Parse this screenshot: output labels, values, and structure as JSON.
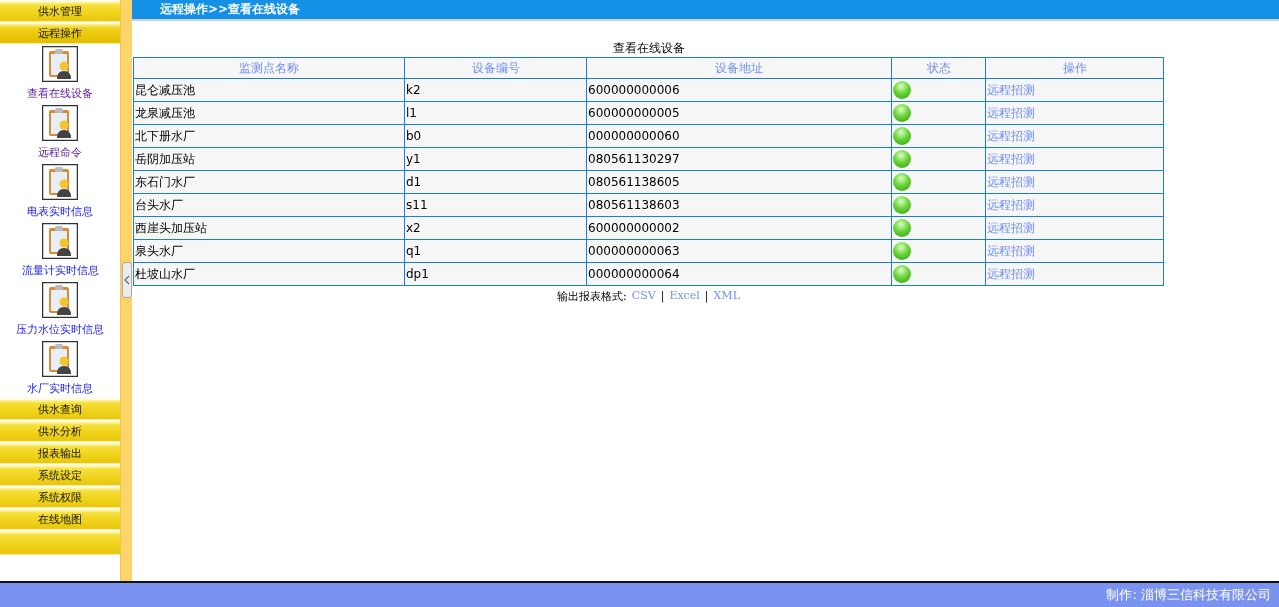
{
  "sidebar": {
    "top_menus": [
      {
        "label": "供水管理",
        "selected": false
      },
      {
        "label": "远程操作",
        "selected": true
      }
    ],
    "items": [
      {
        "label": "查看在线设备",
        "visited": true
      },
      {
        "label": "远程命令",
        "visited": true
      },
      {
        "label": "电表实时信息",
        "visited": false
      },
      {
        "label": "流量计实时信息",
        "visited": false
      },
      {
        "label": "压力水位实时信息",
        "visited": false
      },
      {
        "label": "水厂实时信息",
        "visited": false
      }
    ],
    "bottom_menus": [
      {
        "label": "供水查询",
        "selected": false
      },
      {
        "label": "供水分析",
        "selected": false
      },
      {
        "label": "报表输出",
        "selected": false
      },
      {
        "label": "系统设定",
        "selected": false
      },
      {
        "label": "系统权限",
        "selected": false
      },
      {
        "label": "在线地图",
        "selected": false
      }
    ]
  },
  "breadcrumb": "远程操作>>查看在线设备",
  "table": {
    "caption": "查看在线设备",
    "columns": [
      "监测点名称",
      "设备编号",
      "设备地址",
      "状态",
      "操作"
    ],
    "rows": [
      {
        "name": "昆仑减压池",
        "id": "k2",
        "address": "600000000006",
        "online": true,
        "action": "远程招测"
      },
      {
        "name": "龙泉减压池",
        "id": "l1",
        "address": "600000000005",
        "online": true,
        "action": "远程招测"
      },
      {
        "name": "北下册水厂",
        "id": "b0",
        "address": "000000000060",
        "online": true,
        "action": "远程招测"
      },
      {
        "name": "岳阴加压站",
        "id": "y1",
        "address": "080561130297",
        "online": true,
        "action": "远程招测"
      },
      {
        "name": "东石门水厂",
        "id": "d1",
        "address": "080561138605",
        "online": true,
        "action": "远程招测"
      },
      {
        "name": "台头水厂",
        "id": "s11",
        "address": "080561138603",
        "online": true,
        "action": "远程招测"
      },
      {
        "name": "西崖头加压站",
        "id": "x2",
        "address": "600000000002",
        "online": true,
        "action": "远程招测"
      },
      {
        "name": "泉头水厂",
        "id": "q1",
        "address": "000000000063",
        "online": true,
        "action": "远程招测"
      },
      {
        "name": "杜坡山水厂",
        "id": "dp1",
        "address": "000000000064",
        "online": true,
        "action": "远程招测"
      }
    ]
  },
  "export": {
    "label": "输出报表格式:",
    "formats": [
      "CSV",
      "Excel",
      "XML"
    ],
    "separators": [
      "|",
      "|"
    ]
  },
  "footer": "制作: 淄博三信科技有限公司"
}
